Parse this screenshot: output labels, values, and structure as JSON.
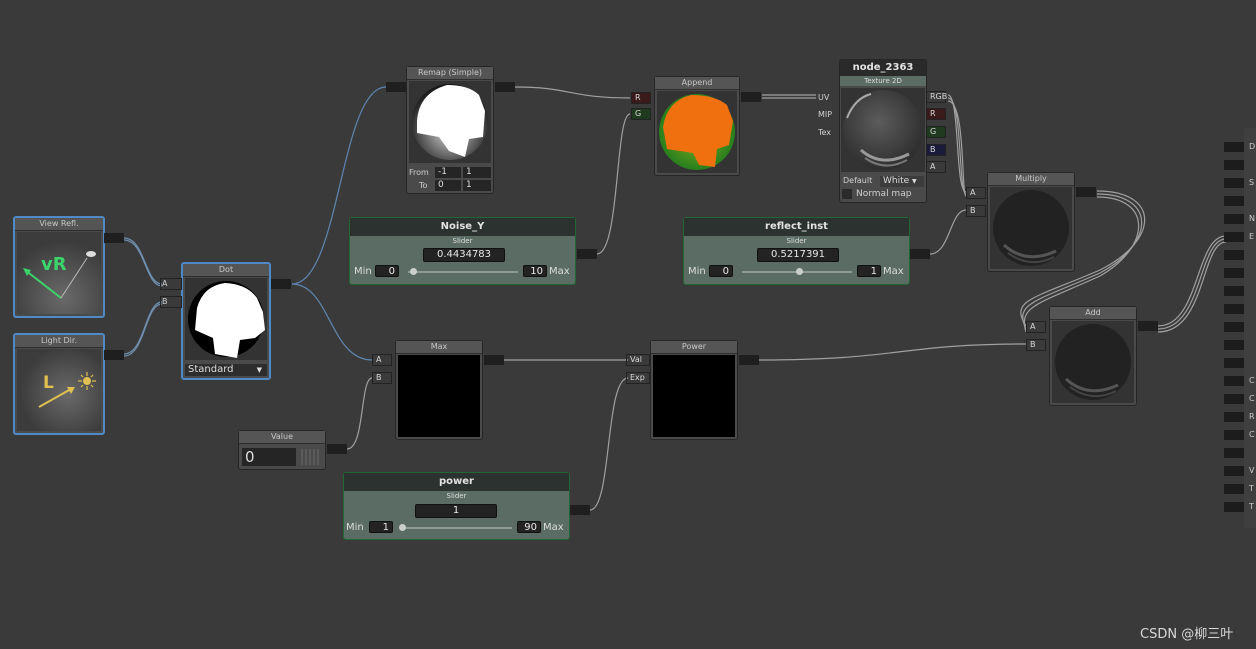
{
  "nodes": {
    "view_refl": {
      "title": "View Refl.",
      "icon_text": "vR"
    },
    "light_dir": {
      "title": "Light Dir.",
      "icon_text": "L"
    },
    "dot": {
      "title": "Dot",
      "port_a": "A",
      "port_b": "B",
      "mode": "Standard"
    },
    "remap": {
      "title": "Remap (Simple)",
      "from_label": "From",
      "to_label": "To",
      "from_min": "-1",
      "from_max": "1",
      "to_min": "0",
      "to_max": "1"
    },
    "append": {
      "title": "Append",
      "port_r": "R",
      "port_g": "G"
    },
    "texture": {
      "name": "node_2363",
      "type": "Texture 2D",
      "in_uv": "UV",
      "in_mip": "MIP",
      "in_tex": "Tex",
      "out_rgb": "RGB",
      "out_r": "R",
      "out_g": "G",
      "out_b": "B",
      "out_a": "A",
      "default_label": "Default",
      "default_value": "White",
      "normal_map_label": "Normal map"
    },
    "multiply": {
      "title": "Multiply",
      "port_a": "A",
      "port_b": "B"
    },
    "add": {
      "title": "Add",
      "port_a": "A",
      "port_b": "B"
    },
    "max": {
      "title": "Max",
      "port_a": "A",
      "port_b": "B"
    },
    "power": {
      "title": "Power",
      "port_val": "Val",
      "port_exp": "Exp"
    },
    "value": {
      "title": "Value",
      "value": "0"
    }
  },
  "sliders": {
    "noise_y": {
      "name": "Noise_Y",
      "kind": "Slider",
      "value": "0.4434783",
      "min_label": "Min",
      "min": "0",
      "max": "10",
      "max_label": "Max",
      "position": 0.04434783
    },
    "reflect_inst": {
      "name": "reflect_inst",
      "kind": "Slider",
      "value": "0.5217391",
      "min_label": "Min",
      "min": "0",
      "max": "1",
      "max_label": "Max",
      "position": 0.5217391
    },
    "power": {
      "name": "power",
      "kind": "Slider",
      "value": "1",
      "min_label": "Min",
      "min": "1",
      "max": "90",
      "max_label": "Max",
      "position": 0.0
    }
  },
  "right_panel_letters": [
    "D",
    "S",
    "N",
    "E",
    "C",
    "C",
    "R",
    "C",
    "V",
    "T",
    "T"
  ],
  "colors": {
    "canvas": "#3a3a3a",
    "node": "#4a4a4a",
    "selected_border": "#4f8ac6",
    "slider_body": "#5a6c64",
    "orange": "#f07010",
    "green": "#3aa040"
  },
  "watermark": "CSDN @柳三叶"
}
